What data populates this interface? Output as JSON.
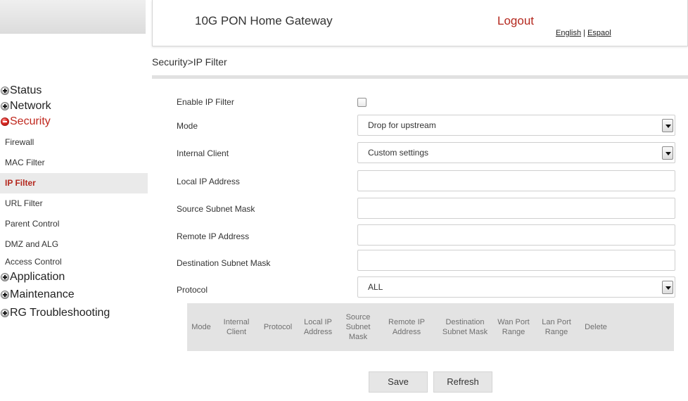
{
  "header": {
    "title": "10G PON Home Gateway",
    "logout": "Logout",
    "lang_english": "English",
    "lang_sep": " | ",
    "lang_espanol": "Espaol"
  },
  "breadcrumb": "Security>IP Filter",
  "sidebar": {
    "status": "Status",
    "network": "Network",
    "security": "Security",
    "security_items": [
      "Firewall",
      "MAC Filter",
      "IP Filter",
      "URL Filter",
      "Parent Control",
      "DMZ and ALG",
      "Access Control"
    ],
    "application": "Application",
    "maintenance": "Maintenance",
    "rg_troubleshooting": "RG Troubleshooting"
  },
  "form": {
    "enable_label": "Enable IP Filter",
    "enable_checked": false,
    "mode_label": "Mode",
    "mode_value": "Drop for upstream",
    "client_label": "Internal Client",
    "client_value": "Custom settings",
    "local_ip_label": "Local IP Address",
    "local_ip_value": "",
    "src_mask_label": "Source Subnet Mask",
    "src_mask_value": "",
    "remote_ip_label": "Remote IP Address",
    "remote_ip_value": "",
    "dst_mask_label": "Destination Subnet Mask",
    "dst_mask_value": "",
    "protocol_label": "Protocol",
    "protocol_value": "ALL"
  },
  "table": {
    "columns": [
      "Mode",
      "Internal Client",
      "Protocol",
      "Local IP Address",
      "Source Subnet Mask",
      "Remote IP Address",
      "Destination Subnet Mask",
      "Wan Port Range",
      "Lan Port Range",
      "Delete"
    ]
  },
  "buttons": {
    "save": "Save",
    "refresh": "Refresh"
  },
  "colors": {
    "accent_red": "#b4281e",
    "table_header_bg": "#e3e3e3"
  }
}
